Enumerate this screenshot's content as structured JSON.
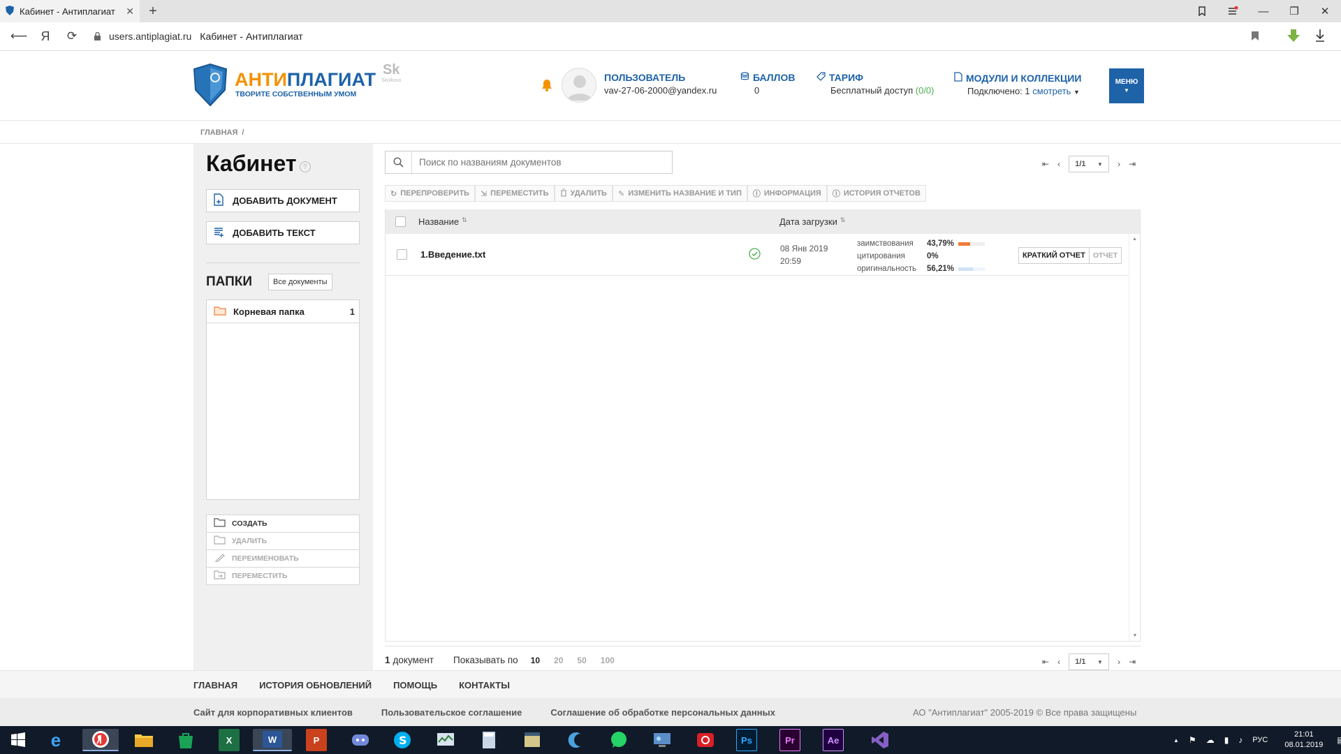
{
  "browser": {
    "tab_title": "Кабинет - Антиплагиат",
    "url_host": "users.antiplagiat.ru",
    "page_title": "Кабинет - Антиплагиат",
    "yandex_glyph": "Я"
  },
  "header": {
    "logo_prefix": "АНТИ",
    "logo_rest": "ПЛАГИАТ",
    "logo_slogan": "ТВОРИТЕ СОБСТВЕННЫМ УМОМ",
    "skolkovo": "Sk",
    "skolkovo_sub": "Skolkovo",
    "user_title": "ПОЛЬЗОВАТЕЛЬ",
    "user_email": "vav-27-06-2000@yandex.ru",
    "points_title": "БАЛЛОВ",
    "points_value": "0",
    "tariff_title": "ТАРИФ",
    "tariff_value": "Бесплатный доступ",
    "tariff_count": "(0/0)",
    "modules_title": "МОДУЛИ И КОЛЛЕКЦИИ",
    "modules_value": "Подключено: 1",
    "modules_link": "смотреть",
    "menu_label": "МЕНЮ"
  },
  "breadcrumb": {
    "home": "ГЛАВНАЯ",
    "sep": "/"
  },
  "sidebar": {
    "title": "Кабинет",
    "add_document": "ДОБАВИТЬ ДОКУМЕНТ",
    "add_text": "ДОБАВИТЬ ТЕКСТ",
    "folders_title": "ПАПКИ",
    "all_docs": "Все документы",
    "root_folder": "Корневая папка",
    "root_count": "1",
    "actions": {
      "create": "СОЗДАТЬ",
      "delete": "УДАЛИТЬ",
      "rename": "ПЕРЕИМЕНОВАТЬ",
      "move": "ПЕРЕМЕСТИТЬ"
    }
  },
  "search": {
    "placeholder": "Поиск по названиям документов"
  },
  "pager": {
    "page": "1/1"
  },
  "toolbar": {
    "recheck": "ПЕРЕПРОВЕРИТЬ",
    "move": "ПЕРЕМЕСТИТЬ",
    "delete": "УДАЛИТЬ",
    "rename": "ИЗМЕНИТЬ НАЗВАНИЕ И ТИП",
    "info": "ИНФОРМАЦИЯ",
    "history": "ИСТОРИЯ ОТЧЕТОВ"
  },
  "table": {
    "col_name": "Название",
    "col_date": "Дата загрузки",
    "rows": [
      {
        "name": "1.Введение.txt",
        "date": "08 Янв 2019",
        "time": "20:59",
        "borrow_label": "заимствования",
        "borrow_value": "43,79%",
        "borrow_fraction": 0.4379,
        "cite_label": "цитирования",
        "cite_value": "0%",
        "cite_fraction": 0,
        "orig_label": "оригинальность",
        "orig_value": "56,21%",
        "orig_fraction": 0.5621,
        "brief_report": "КРАТКИЙ ОТЧЕТ",
        "report": "ОТЧЕТ"
      }
    ]
  },
  "bottom": {
    "count_num": "1",
    "count_word": "документ",
    "show_by": "Показывать по",
    "sizes": [
      "10",
      "20",
      "50",
      "100"
    ]
  },
  "footer": {
    "links": [
      "ГЛАВНАЯ",
      "ИСТОРИЯ ОБНОВЛЕНИЙ",
      "ПОМОЩЬ",
      "КОНТАКТЫ"
    ],
    "links2": [
      "Сайт для корпоративных клиентов",
      "Пользовательское соглашение",
      "Соглашение об обработке персональных данных"
    ],
    "copyright": "АО \"Антиплагиат\" 2005-2019 © Все права защищены"
  },
  "taskbar": {
    "lang": "РУС",
    "time": "21:01",
    "date": "08.01.2019",
    "apps": [
      "X",
      "P",
      "Ps",
      "Pr",
      "Ae"
    ]
  },
  "colors": {
    "brand_blue": "#1e62a8",
    "brand_orange": "#f39200",
    "borrow": "#f07c3a",
    "orig": "#cfe3f5",
    "ok_green": "#4caf50"
  }
}
